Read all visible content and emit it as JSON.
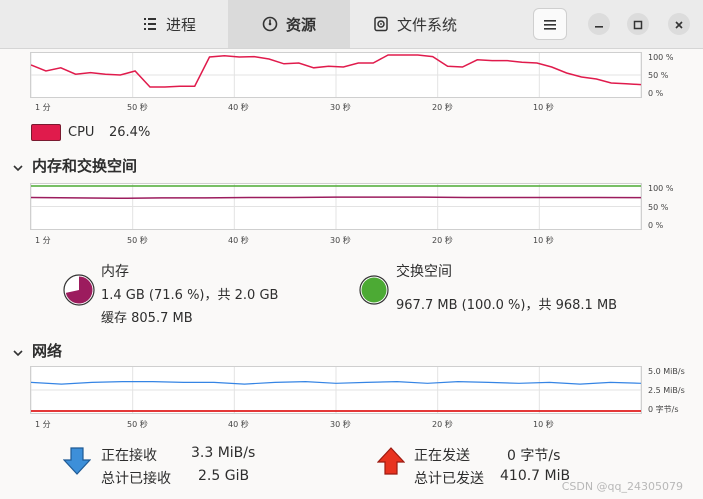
{
  "tabs": [
    {
      "label": "进程",
      "icon": "list-icon"
    },
    {
      "label": "资源",
      "icon": "gauge-icon"
    },
    {
      "label": "文件系统",
      "icon": "disk-icon"
    }
  ],
  "header_buttons": {
    "menu_icon": "hamburger-icon",
    "minimize": "minimize-icon",
    "maximize": "maximize-icon",
    "close": "close-icon"
  },
  "x_axis_labels": [
    "1 分",
    "50 秒",
    "40 秒",
    "30 秒",
    "20 秒",
    "10 秒"
  ],
  "cpu": {
    "y_labels": [
      "100 %",
      "50 %",
      "0 %"
    ],
    "legend_label": "CPU",
    "legend_value": "26.4%",
    "color": "#e01b4c"
  },
  "memory_section": {
    "title": "内存和交换空间",
    "y_labels": [
      "100 %",
      "50 %",
      "0 %"
    ],
    "memory": {
      "title": "内存",
      "usage": "1.4 GB (71.6 %)，共 2.0 GB",
      "cache": "缓存 805.7 MB",
      "color": "#9c1c5e",
      "percent": 71.6
    },
    "swap": {
      "title": "交换空间",
      "usage": "967.7 MB (100.0 %)，共 968.1 MB",
      "color": "#4caa34",
      "percent": 100.0
    }
  },
  "network_section": {
    "title": "网络",
    "y_labels": [
      "5.0 MiB/s",
      "2.5 MiB/s",
      "0 字节/s"
    ],
    "receiving_label": "正在接收",
    "receiving_value": "3.3 MiB/s",
    "total_received_label": "总计已接收",
    "total_received_value": "2.5 GiB",
    "sending_label": "正在发送",
    "sending_value": "0 字节/s",
    "total_sent_label": "总计已发送",
    "total_sent_value": "410.7 MiB",
    "receive_color": "#3584e4",
    "send_color": "#e01b1b"
  },
  "watermark": "CSDN @qq_24305079",
  "chart_data": [
    {
      "type": "line",
      "title": "CPU",
      "x": [
        "1 分",
        "50 秒",
        "40 秒",
        "30 秒",
        "20 秒",
        "10 秒"
      ],
      "ylim": [
        0,
        100
      ],
      "series": [
        {
          "name": "CPU",
          "values": [
            75,
            60,
            68,
            52,
            56,
            52,
            50,
            60,
            20,
            20,
            22,
            22,
            95,
            98,
            95,
            96,
            90,
            78,
            80,
            68,
            72,
            70,
            80,
            80,
            100,
            100,
            100,
            96,
            72,
            70,
            88,
            86,
            86,
            82,
            80,
            70,
            55,
            45,
            40,
            30,
            28,
            26
          ]
        }
      ]
    },
    {
      "type": "line",
      "title": "内存和交换空间",
      "ylim": [
        0,
        100
      ],
      "series": [
        {
          "name": "内存",
          "values": [
            72,
            71,
            70,
            71,
            71,
            72,
            72,
            73,
            73,
            73,
            72,
            72,
            72,
            72,
            71.6
          ]
        },
        {
          "name": "交换空间",
          "values": [
            100,
            100,
            100,
            100,
            100,
            100,
            100,
            100,
            100,
            100,
            100,
            100,
            100,
            100,
            100
          ]
        }
      ]
    },
    {
      "type": "line",
      "title": "网络",
      "ylim": [
        0,
        5.0
      ],
      "series": [
        {
          "name": "正在接收",
          "values": [
            3.4,
            3.2,
            3.4,
            3.5,
            3.5,
            3.4,
            3.4,
            3.2,
            3.4,
            3.5,
            3.3,
            3.4,
            3.5,
            3.3,
            3.5,
            3.4,
            3.3,
            3.4,
            3.2,
            3.4,
            3.3
          ]
        },
        {
          "name": "正在发送",
          "values": [
            0,
            0,
            0,
            0,
            0,
            0,
            0,
            0,
            0,
            0,
            0,
            0,
            0,
            0,
            0,
            0,
            0,
            0,
            0,
            0,
            0
          ]
        }
      ]
    }
  ]
}
